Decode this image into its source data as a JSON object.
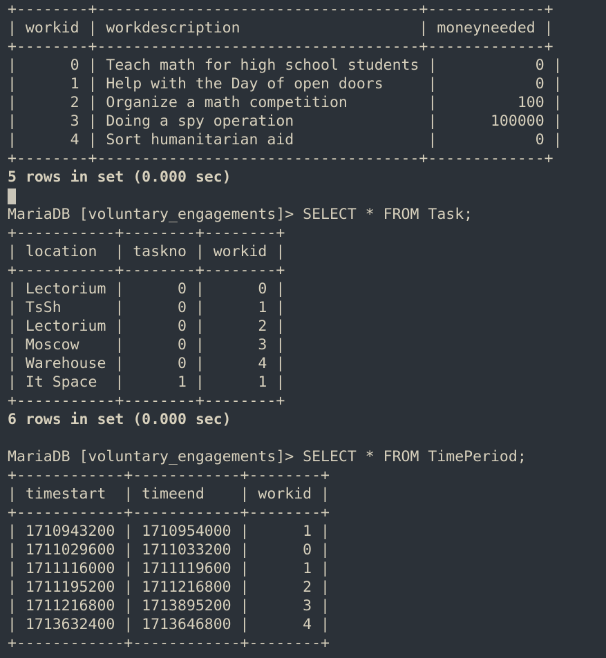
{
  "terminal": {
    "lines": [
      {
        "type": "border",
        "text": "+--------+------------------------------------+-------------+"
      },
      {
        "type": "row",
        "text": "| workid | workdescription                    | moneyneeded |"
      },
      {
        "type": "border",
        "text": "+--------+------------------------------------+-------------+"
      },
      {
        "type": "row",
        "text": "|      0 | Teach math for high school students |           0 |"
      },
      {
        "type": "row",
        "text": "|      1 | Help with the Day of open doors     |           0 |"
      },
      {
        "type": "row",
        "text": "|      2 | Organize a math competition         |         100 |"
      },
      {
        "type": "row",
        "text": "|      3 | Doing a spy operation               |      100000 |"
      },
      {
        "type": "row",
        "text": "|      4 | Sort humanitarian aid               |           0 |"
      },
      {
        "type": "border",
        "text": "+--------+------------------------------------+-------------+"
      },
      {
        "type": "result",
        "text": "5 rows in set (0.000 sec)"
      },
      {
        "type": "cursor",
        "text": ""
      },
      {
        "type": "prompt",
        "text": "MariaDB [voluntary_engagements]> SELECT * FROM Task;"
      },
      {
        "type": "border",
        "text": "+-----------+--------+--------+"
      },
      {
        "type": "row",
        "text": "| location  | taskno | workid |"
      },
      {
        "type": "border",
        "text": "+-----------+--------+--------+"
      },
      {
        "type": "row",
        "text": "| Lectorium |      0 |      0 |"
      },
      {
        "type": "row",
        "text": "| TsSh      |      0 |      1 |"
      },
      {
        "type": "row",
        "text": "| Lectorium |      0 |      2 |"
      },
      {
        "type": "row",
        "text": "| Moscow    |      0 |      3 |"
      },
      {
        "type": "row",
        "text": "| Warehouse |      0 |      4 |"
      },
      {
        "type": "row",
        "text": "| It Space  |      1 |      1 |"
      },
      {
        "type": "border",
        "text": "+-----------+--------+--------+"
      },
      {
        "type": "result",
        "text": "6 rows in set (0.000 sec)"
      },
      {
        "type": "blank",
        "text": ""
      },
      {
        "type": "prompt",
        "text": "MariaDB [voluntary_engagements]> SELECT * FROM TimePeriod;"
      },
      {
        "type": "border",
        "text": "+------------+------------+--------+"
      },
      {
        "type": "row",
        "text": "| timestart  | timeend    | workid |"
      },
      {
        "type": "border",
        "text": "+------------+------------+--------+"
      },
      {
        "type": "row",
        "text": "| 1710943200 | 1710954000 |      1 |"
      },
      {
        "type": "row",
        "text": "| 1711029600 | 1711033200 |      0 |"
      },
      {
        "type": "row",
        "text": "| 1711116000 | 1711119600 |      1 |"
      },
      {
        "type": "row",
        "text": "| 1711195200 | 1711216800 |      2 |"
      },
      {
        "type": "row",
        "text": "| 1711216800 | 1713895200 |      3 |"
      },
      {
        "type": "row",
        "text": "| 1713632400 | 1713646800 |      4 |"
      },
      {
        "type": "border",
        "text": "+------------+------------+--------+"
      }
    ]
  }
}
